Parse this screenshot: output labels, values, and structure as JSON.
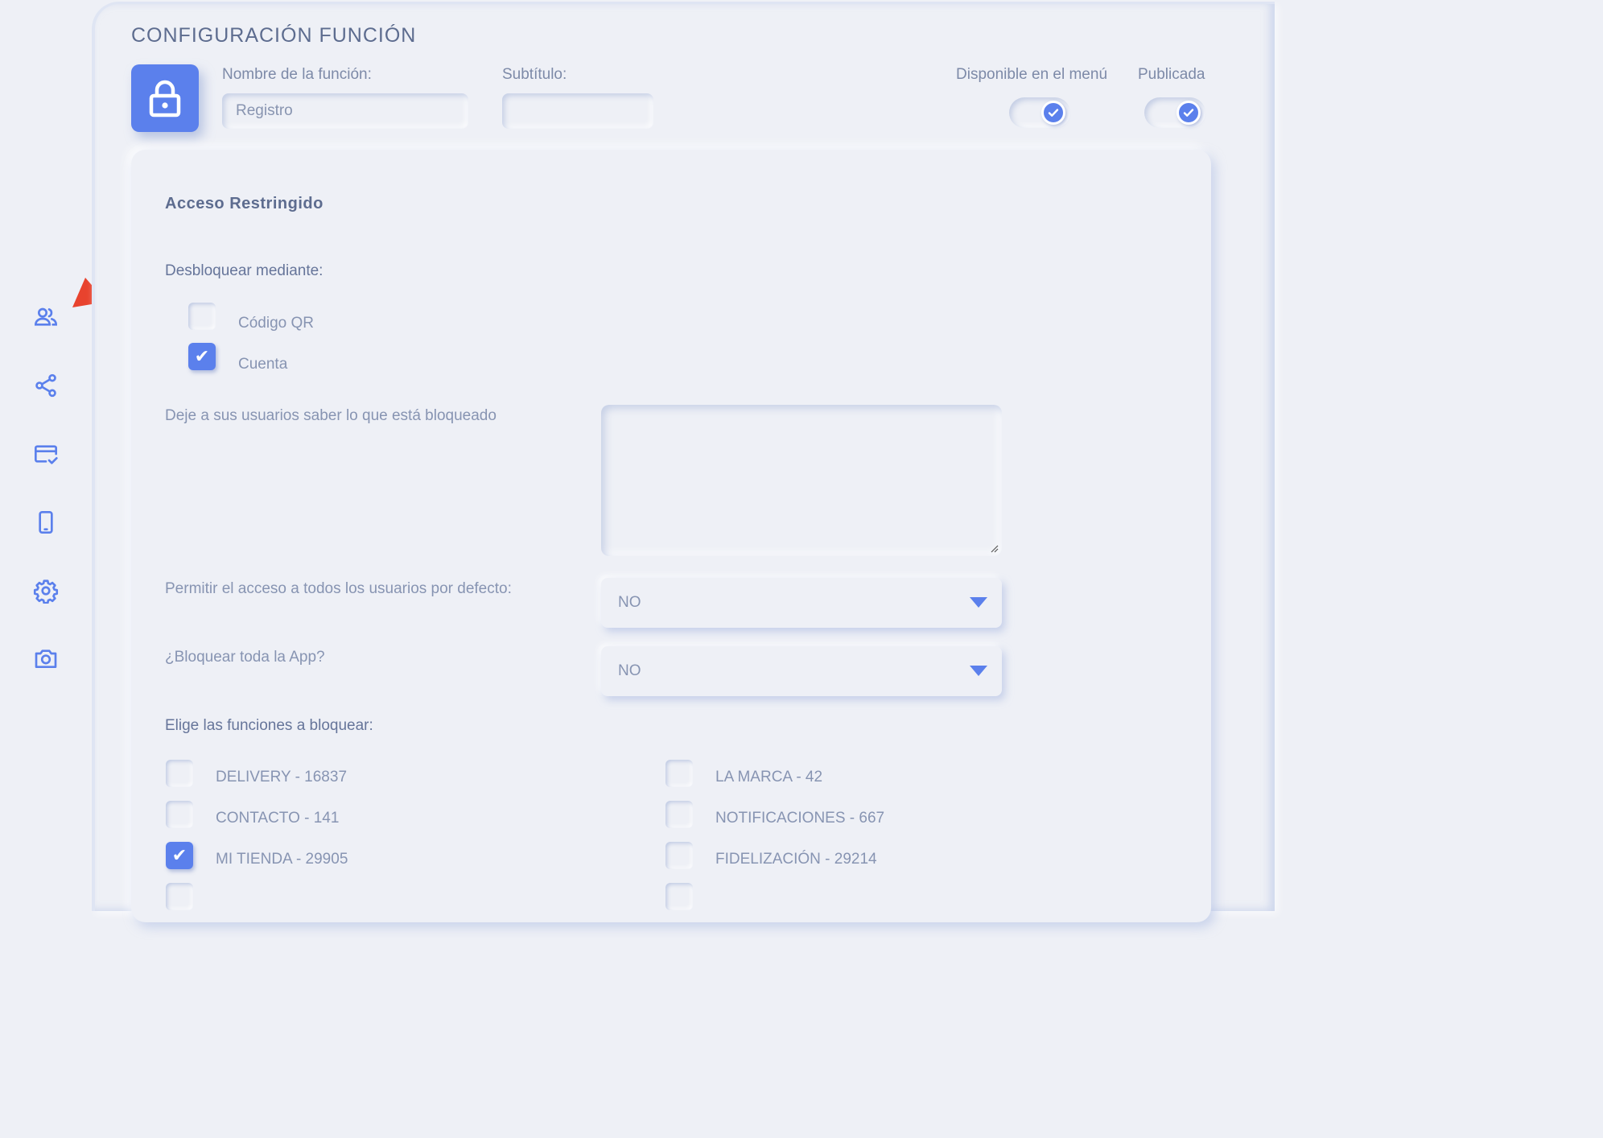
{
  "sidebar": {
    "items": [
      {
        "icon": "users-icon"
      },
      {
        "icon": "share-icon"
      },
      {
        "icon": "card-check-icon"
      },
      {
        "icon": "phone-icon"
      },
      {
        "icon": "gear-icon"
      },
      {
        "icon": "camera-icon"
      }
    ]
  },
  "header": {
    "title": "CONFIGURACIÓN FUNCIÓN",
    "name_label": "Nombre de la función:",
    "name_value": "Registro",
    "subtitle_label": "Subtítulo:",
    "subtitle_value": "",
    "menu_label": "Disponible en el menú",
    "menu_on": true,
    "published_label": "Publicada",
    "published_on": true
  },
  "restricted": {
    "title": "Acceso Restringido",
    "unlock_label": "Desbloquear mediante:",
    "unlock_options": [
      {
        "label": "Código QR",
        "checked": false
      },
      {
        "label": "Cuenta",
        "checked": true
      }
    ],
    "message_label": "Deje a sus usuarios saber lo que está bloqueado",
    "message_value": "",
    "allow_all_label": "Permitir el acceso a todos los usuarios por defecto:",
    "allow_all_value": "NO",
    "block_app_label": "¿Bloquear toda la App?",
    "block_app_value": "NO",
    "functions_label": "Elige las funciones a bloquear:",
    "functions_left": [
      {
        "label": "DELIVERY - 16837",
        "checked": false
      },
      {
        "label": "CONTACTO - 141",
        "checked": false
      },
      {
        "label": "MI TIENDA - 29905",
        "checked": true
      }
    ],
    "functions_right": [
      {
        "label": "LA MARCA - 42",
        "checked": false
      },
      {
        "label": "NOTIFICACIONES - 667",
        "checked": false
      },
      {
        "label": "FIDELIZACIÓN - 29214",
        "checked": false
      }
    ]
  },
  "colors": {
    "accent": "#5b80ec",
    "background": "#eef0f6",
    "annotation": "#e8432e"
  }
}
